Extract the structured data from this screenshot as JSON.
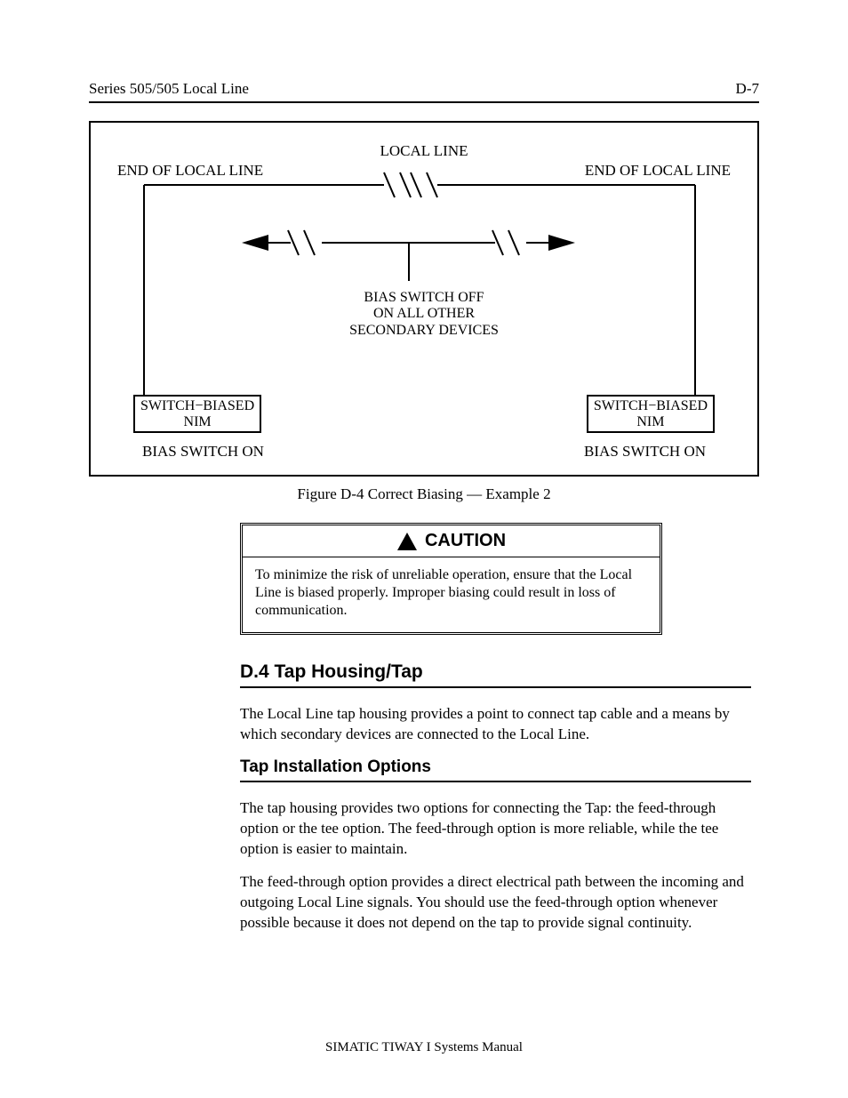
{
  "header": {
    "left": "Series 505/505 Local Line",
    "right": "D-7"
  },
  "figure": {
    "local_line": "LOCAL LINE",
    "end_left": "END OF LOCAL LINE",
    "end_right": "END OF LOCAL LINE",
    "bias_off_line1": "BIAS SWITCH OFF",
    "bias_off_line2": "ON ALL OTHER",
    "bias_off_line3": "SECONDARY DEVICES",
    "nim_left_l1": "SWITCH−BIASED",
    "nim_left_l2": "NIM",
    "nim_right_l1": "SWITCH−BIASED",
    "nim_right_l2": "NIM",
    "bias_on_left": "BIAS SWITCH ON",
    "bias_on_right": "BIAS SWITCH ON",
    "caption": "Figure D-4   Correct Biasing — Example 2"
  },
  "caution": {
    "title": "CAUTION",
    "body": "To minimize the risk of unreliable operation, ensure that the Local Line is biased properly. Improper biasing could result in loss of communication."
  },
  "sections": {
    "s1_title": "D.4  Tap Housing/Tap",
    "s1_p1": "The Local Line tap housing provides a point to connect tap cable and a means by which secondary devices are connected to the Local Line.",
    "s2_title": "Tap Installation Options",
    "s2_p1": "The tap housing provides two options for connecting the Tap: the feed-through option or the tee option. The feed-through option is more reliable, while the tee option is easier to maintain.",
    "s2_p2": "The feed-through option provides a direct electrical path between the incoming and outgoing Local Line signals. You should use the feed-through option whenever possible because it does not depend on the tap to provide signal continuity."
  },
  "footer": "SIMATIC TIWAY I  Systems Manual"
}
